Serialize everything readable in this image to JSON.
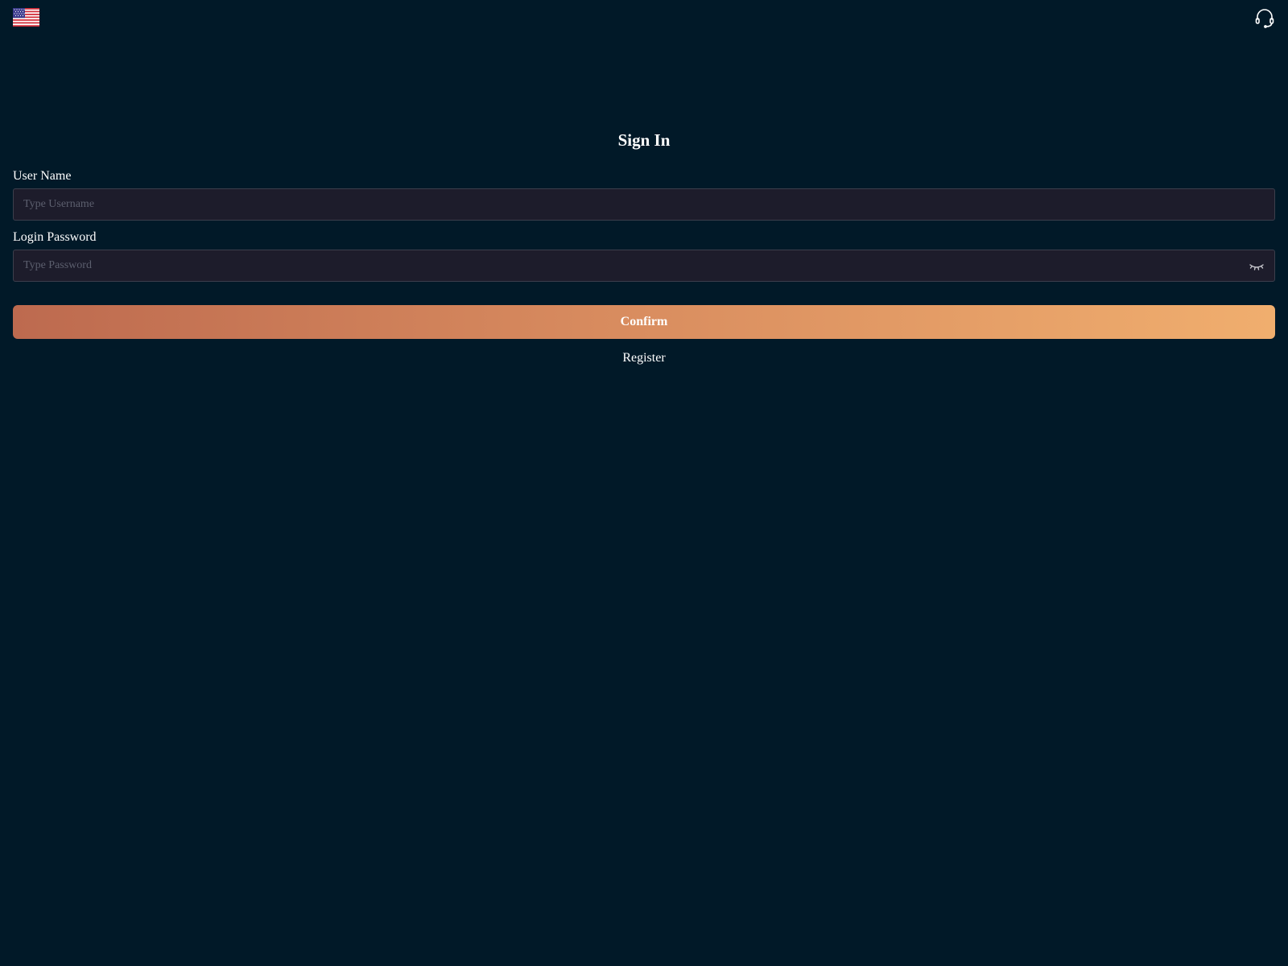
{
  "header": {
    "language_icon": "us-flag-icon",
    "support_icon": "headset-icon"
  },
  "form": {
    "title": "Sign In",
    "username": {
      "label": "User Name",
      "placeholder": "Type Username",
      "value": ""
    },
    "password": {
      "label": "Login Password",
      "placeholder": "Type Password",
      "value": "",
      "visibility_icon": "eye-closed-icon"
    },
    "confirm_label": "Confirm",
    "register_label": "Register"
  },
  "colors": {
    "background": "#011928",
    "field_background": "#1d1c2b",
    "field_border": "#3c3e4c",
    "button_gradient_start": "#bd6a4f",
    "button_gradient_end": "#f0ae6e"
  }
}
